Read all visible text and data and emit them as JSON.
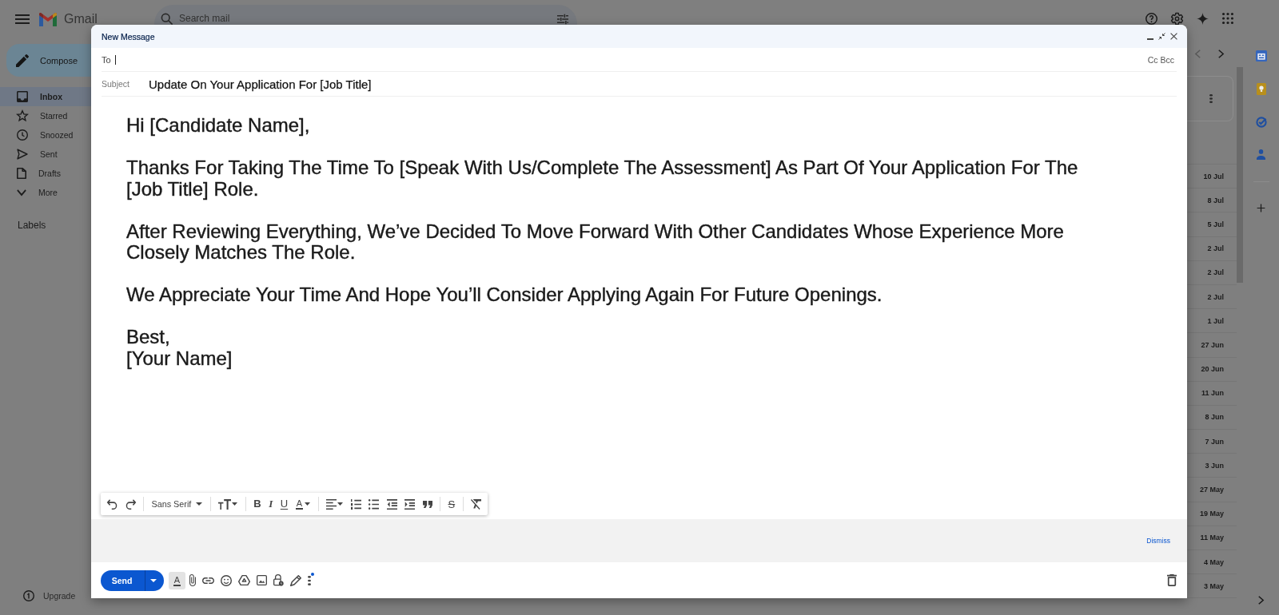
{
  "header": {
    "logo_text": "Gmail",
    "search": {
      "placeholder": "Search mail"
    }
  },
  "sidebar": {
    "compose_label": "Compose",
    "items": [
      {
        "label": "Inbox",
        "kind": "inbox",
        "selected": true
      },
      {
        "label": "Starred",
        "kind": "starred",
        "selected": false
      },
      {
        "label": "Snoozed",
        "kind": "snoozed",
        "selected": false
      },
      {
        "label": "Sent",
        "kind": "sent",
        "selected": false
      },
      {
        "label": "Drafts",
        "kind": "drafts",
        "selected": false
      },
      {
        "label": "More",
        "kind": "more",
        "selected": false
      }
    ],
    "labels_heading": "Labels",
    "upgrade_label": "Upgrade"
  },
  "message_list": {
    "dates": [
      "10 Jul",
      "8 Jul",
      "5 Jul",
      "2 Jul",
      "2 Jul",
      "2 Jul",
      "1 Jul",
      "27 Jun",
      "20 Jun",
      "11 Jun",
      "8 Jun",
      "7 Jun",
      "3 Jun",
      "27 May",
      "19 May",
      "11 May",
      "4 May",
      "3 May"
    ]
  },
  "compose": {
    "title": "New Message",
    "to_label": "To",
    "cc_label": "Cc",
    "bcc_label": "Bcc",
    "subject_label": "Subject",
    "subject": "Update On Your Application For [Job Title]",
    "body": {
      "paragraphs": [
        "Hi [Candidate Name],",
        "Thanks For Taking The Time To [Speak With Us/Complete The Assessment] As Part Of Your Application For The [Job Title] Role.",
        "After Reviewing Everything, We’ve Decided To Move Forward With Other Candidates Whose Experience More Closely Matches The Role.",
        "We Appreciate Your Time And Hope You’ll Consider Applying Again For Future Openings."
      ],
      "signature": [
        "Best,",
        "[Your Name]"
      ]
    },
    "format_bar": {
      "font": "Sans Serif",
      "text_styles": [
        {
          "kind": "bold",
          "label": "B"
        },
        {
          "kind": "italic",
          "label": "I"
        },
        {
          "kind": "underline",
          "label": "U"
        },
        {
          "kind": "color",
          "label": "A"
        }
      ],
      "strikethrough_label": "S"
    },
    "notice": {
      "action": "Dismiss"
    },
    "send_label": "Send",
    "formatting_toggle": {
      "label": "A",
      "selected": true
    },
    "more_options_badge": true
  }
}
